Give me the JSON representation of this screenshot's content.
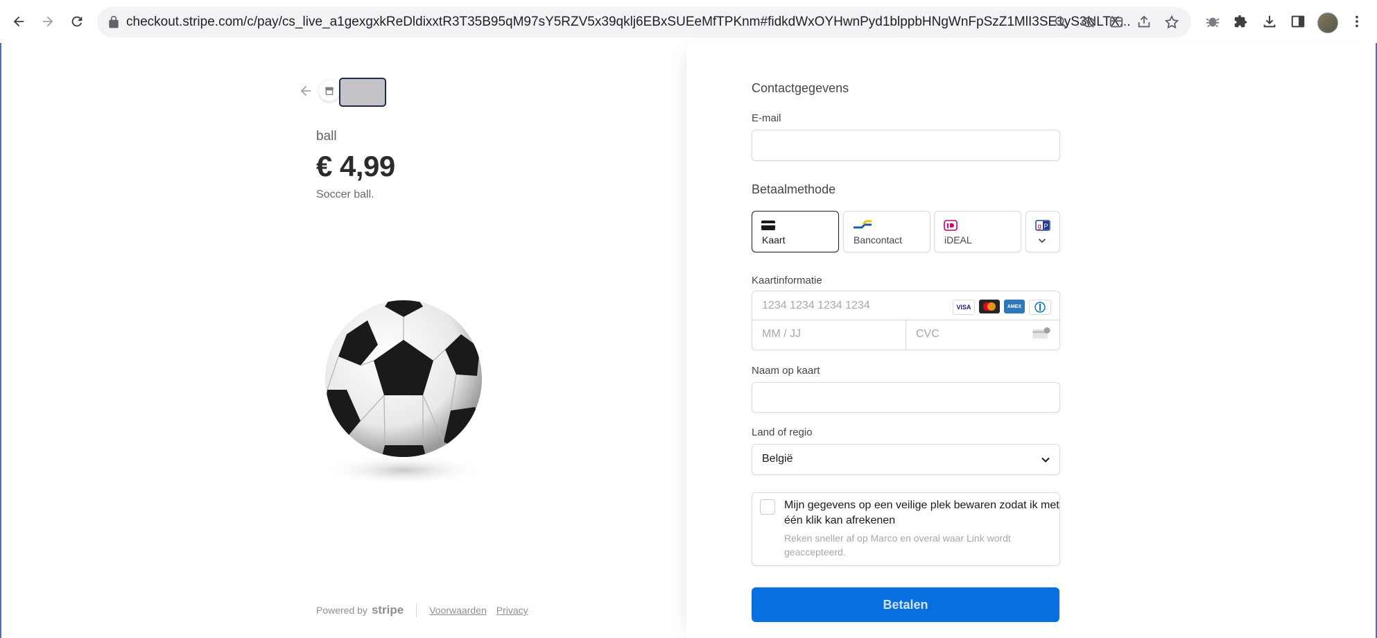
{
  "browser": {
    "url": "checkout.stripe.com/c/pay/cs_live_a1gexgxkReDldixxtR3T35B95qM97sY5RZV5x39qklj6EBxSUEeMfTPKnm#fidkdWxOYHwnPyd1blppbHNgWnFpSzZ1MlI3SE1yS3NLTX..."
  },
  "product": {
    "name": "ball",
    "price": "€ 4,99",
    "description": "Soccer ball."
  },
  "footer": {
    "powered_by": "Powered by",
    "stripe": "stripe",
    "terms": "Voorwaarden",
    "privacy": "Privacy"
  },
  "contact": {
    "title": "Contactgegevens",
    "email_label": "E-mail",
    "email_value": ""
  },
  "payment": {
    "title": "Betaalmethode",
    "methods": [
      {
        "label": "Kaart",
        "icon": "card-icon",
        "selected": true
      },
      {
        "label": "Bancontact",
        "icon": "bancontact-icon",
        "selected": false
      },
      {
        "label": "iDEAL",
        "icon": "ideal-icon",
        "selected": false
      },
      {
        "label": "",
        "icon": "giropay-icon",
        "selected": false
      }
    ],
    "card_info_label": "Kaartinformatie",
    "card_number_placeholder": "1234 1234 1234 1234",
    "expiry_placeholder": "MM / JJ",
    "cvc_placeholder": "CVC",
    "brands": [
      "VISA",
      "mastercard",
      "amex",
      "diners"
    ]
  },
  "name_on_card": {
    "label": "Naam op kaart",
    "value": ""
  },
  "country": {
    "label": "Land of regio",
    "value": "België"
  },
  "save_info": {
    "title": "Mijn gegevens op een veilige plek bewaren zodat ik met één klik kan afrekenen",
    "subtitle": "Reken sneller af op Marco en overal waar Link wordt geaccepteerd.",
    "checked": false
  },
  "pay_button": "Betalen",
  "colors": {
    "primary": "#0a6fde",
    "frame": "#4a6fb5"
  }
}
